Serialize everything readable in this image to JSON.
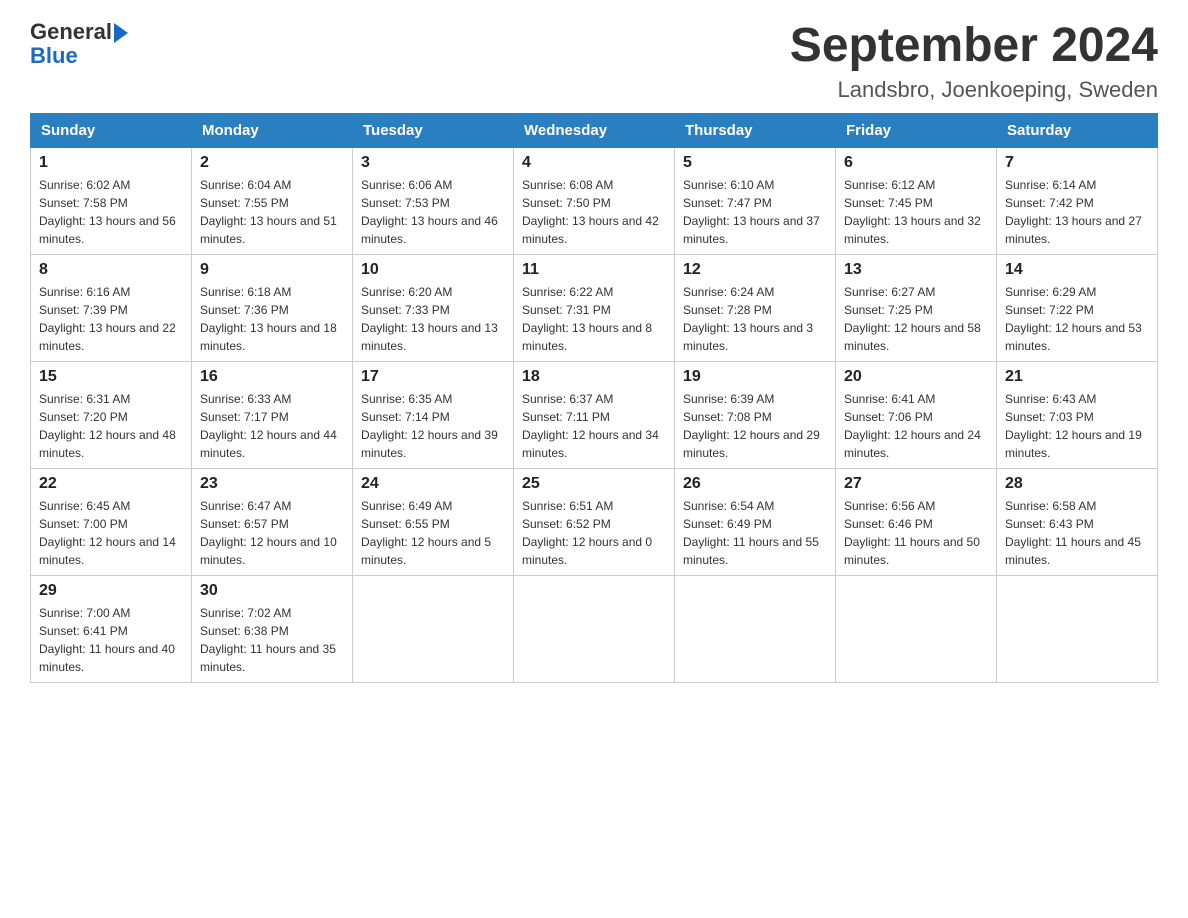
{
  "logo": {
    "text_general": "General",
    "text_blue": "Blue",
    "arrow": "▶"
  },
  "title": "September 2024",
  "subtitle": "Landsbro, Joenkoeping, Sweden",
  "weekdays": [
    "Sunday",
    "Monday",
    "Tuesday",
    "Wednesday",
    "Thursday",
    "Friday",
    "Saturday"
  ],
  "weeks": [
    [
      {
        "day": "1",
        "sunrise": "6:02 AM",
        "sunset": "7:58 PM",
        "daylight": "13 hours and 56 minutes."
      },
      {
        "day": "2",
        "sunrise": "6:04 AM",
        "sunset": "7:55 PM",
        "daylight": "13 hours and 51 minutes."
      },
      {
        "day": "3",
        "sunrise": "6:06 AM",
        "sunset": "7:53 PM",
        "daylight": "13 hours and 46 minutes."
      },
      {
        "day": "4",
        "sunrise": "6:08 AM",
        "sunset": "7:50 PM",
        "daylight": "13 hours and 42 minutes."
      },
      {
        "day": "5",
        "sunrise": "6:10 AM",
        "sunset": "7:47 PM",
        "daylight": "13 hours and 37 minutes."
      },
      {
        "day": "6",
        "sunrise": "6:12 AM",
        "sunset": "7:45 PM",
        "daylight": "13 hours and 32 minutes."
      },
      {
        "day": "7",
        "sunrise": "6:14 AM",
        "sunset": "7:42 PM",
        "daylight": "13 hours and 27 minutes."
      }
    ],
    [
      {
        "day": "8",
        "sunrise": "6:16 AM",
        "sunset": "7:39 PM",
        "daylight": "13 hours and 22 minutes."
      },
      {
        "day": "9",
        "sunrise": "6:18 AM",
        "sunset": "7:36 PM",
        "daylight": "13 hours and 18 minutes."
      },
      {
        "day": "10",
        "sunrise": "6:20 AM",
        "sunset": "7:33 PM",
        "daylight": "13 hours and 13 minutes."
      },
      {
        "day": "11",
        "sunrise": "6:22 AM",
        "sunset": "7:31 PM",
        "daylight": "13 hours and 8 minutes."
      },
      {
        "day": "12",
        "sunrise": "6:24 AM",
        "sunset": "7:28 PM",
        "daylight": "13 hours and 3 minutes."
      },
      {
        "day": "13",
        "sunrise": "6:27 AM",
        "sunset": "7:25 PM",
        "daylight": "12 hours and 58 minutes."
      },
      {
        "day": "14",
        "sunrise": "6:29 AM",
        "sunset": "7:22 PM",
        "daylight": "12 hours and 53 minutes."
      }
    ],
    [
      {
        "day": "15",
        "sunrise": "6:31 AM",
        "sunset": "7:20 PM",
        "daylight": "12 hours and 48 minutes."
      },
      {
        "day": "16",
        "sunrise": "6:33 AM",
        "sunset": "7:17 PM",
        "daylight": "12 hours and 44 minutes."
      },
      {
        "day": "17",
        "sunrise": "6:35 AM",
        "sunset": "7:14 PM",
        "daylight": "12 hours and 39 minutes."
      },
      {
        "day": "18",
        "sunrise": "6:37 AM",
        "sunset": "7:11 PM",
        "daylight": "12 hours and 34 minutes."
      },
      {
        "day": "19",
        "sunrise": "6:39 AM",
        "sunset": "7:08 PM",
        "daylight": "12 hours and 29 minutes."
      },
      {
        "day": "20",
        "sunrise": "6:41 AM",
        "sunset": "7:06 PM",
        "daylight": "12 hours and 24 minutes."
      },
      {
        "day": "21",
        "sunrise": "6:43 AM",
        "sunset": "7:03 PM",
        "daylight": "12 hours and 19 minutes."
      }
    ],
    [
      {
        "day": "22",
        "sunrise": "6:45 AM",
        "sunset": "7:00 PM",
        "daylight": "12 hours and 14 minutes."
      },
      {
        "day": "23",
        "sunrise": "6:47 AM",
        "sunset": "6:57 PM",
        "daylight": "12 hours and 10 minutes."
      },
      {
        "day": "24",
        "sunrise": "6:49 AM",
        "sunset": "6:55 PM",
        "daylight": "12 hours and 5 minutes."
      },
      {
        "day": "25",
        "sunrise": "6:51 AM",
        "sunset": "6:52 PM",
        "daylight": "12 hours and 0 minutes."
      },
      {
        "day": "26",
        "sunrise": "6:54 AM",
        "sunset": "6:49 PM",
        "daylight": "11 hours and 55 minutes."
      },
      {
        "day": "27",
        "sunrise": "6:56 AM",
        "sunset": "6:46 PM",
        "daylight": "11 hours and 50 minutes."
      },
      {
        "day": "28",
        "sunrise": "6:58 AM",
        "sunset": "6:43 PM",
        "daylight": "11 hours and 45 minutes."
      }
    ],
    [
      {
        "day": "29",
        "sunrise": "7:00 AM",
        "sunset": "6:41 PM",
        "daylight": "11 hours and 40 minutes."
      },
      {
        "day": "30",
        "sunrise": "7:02 AM",
        "sunset": "6:38 PM",
        "daylight": "11 hours and 35 minutes."
      },
      null,
      null,
      null,
      null,
      null
    ]
  ]
}
